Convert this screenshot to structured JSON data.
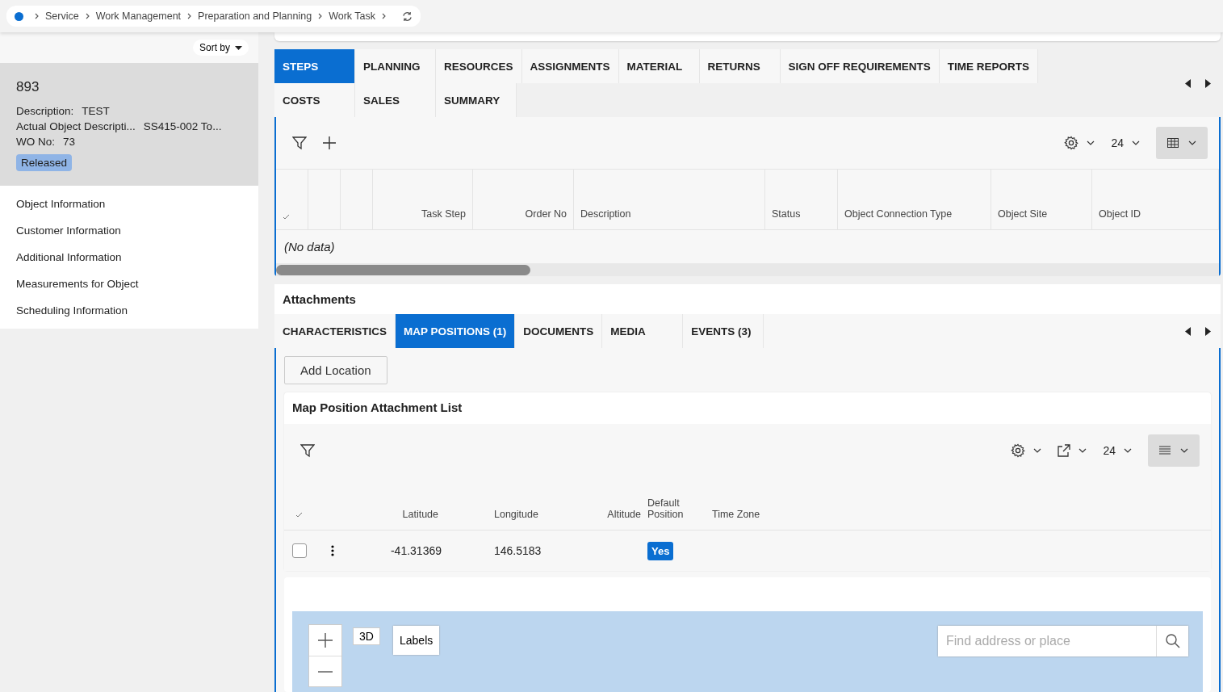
{
  "breadcrumb": {
    "items": [
      "Service",
      "Work Management",
      "Preparation and Planning",
      "Work Task"
    ]
  },
  "sidebar": {
    "sort_label": "Sort by",
    "record": {
      "title": "893",
      "fields": [
        {
          "label": "Description:",
          "value": "TEST"
        },
        {
          "label": "Actual Object Descripti...",
          "value": "SS415-002 To..."
        },
        {
          "label": "WO No:",
          "value": "73"
        }
      ],
      "status": "Released"
    },
    "links": [
      "Object Information",
      "Customer Information",
      "Additional Information",
      "Measurements for Object",
      "Scheduling Information"
    ]
  },
  "tabs": [
    {
      "label": "STEPS",
      "selected": true
    },
    {
      "label": "PLANNING",
      "selected": false
    },
    {
      "label": "RESOURCES",
      "selected": false
    },
    {
      "label": "ASSIGNMENTS",
      "selected": false
    },
    {
      "label": "MATERIAL",
      "selected": false
    },
    {
      "label": "RETURNS",
      "selected": false
    },
    {
      "label": "SIGN OFF REQUIREMENTS",
      "selected": false
    },
    {
      "label": "TIME REPORTS",
      "selected": false
    },
    {
      "label": "COSTS",
      "selected": false
    },
    {
      "label": "SALES",
      "selected": false
    },
    {
      "label": "SUMMARY",
      "selected": false
    }
  ],
  "steps_table": {
    "page_size": "24",
    "columns": [
      "Task Step",
      "Order No",
      "Description",
      "Status",
      "Object Connection Type",
      "Object Site",
      "Object ID"
    ],
    "empty_text": "(No data)"
  },
  "attachments": {
    "title": "Attachments",
    "tabs": [
      {
        "label": "CHARACTERISTICS",
        "selected": false
      },
      {
        "label": "MAP POSITIONS (1)",
        "selected": true
      },
      {
        "label": "DOCUMENTS",
        "selected": false
      },
      {
        "label": "MEDIA",
        "selected": false
      },
      {
        "label": "EVENTS (3)",
        "selected": false
      }
    ],
    "add_button": "Add Location",
    "list": {
      "title": "Map Position Attachment List",
      "page_size": "24",
      "columns": [
        "Latitude",
        "Longitude",
        "Altitude",
        "Default Position",
        "Time Zone"
      ],
      "rows": [
        {
          "checked": false,
          "latitude": "-41.31369",
          "longitude": "146.5183",
          "altitude": "",
          "default_position": "Yes",
          "time_zone": ""
        }
      ]
    },
    "map": {
      "mode_button": "3D",
      "labels_button": "Labels",
      "search_placeholder": "Find address or place"
    }
  }
}
